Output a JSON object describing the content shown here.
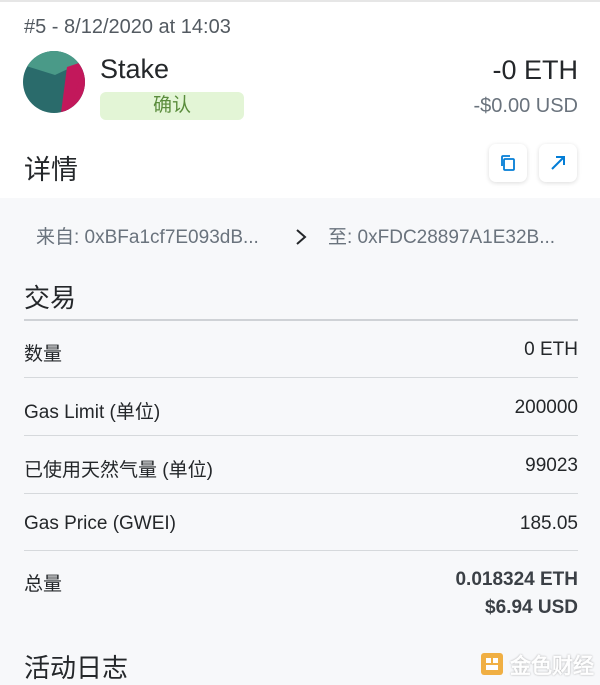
{
  "header": {
    "txn_id": "#5 - 8/12/2020 at 14:03",
    "title": "Stake",
    "status": "确认",
    "amount": "-0 ETH",
    "fiat_amount": "-$0.00 USD"
  },
  "details": {
    "title": "详情",
    "from": "来自: 0xBFa1cf7E093dB...",
    "to": "至: 0xFDC28897A1E32B..."
  },
  "transaction": {
    "title": "交易",
    "rows": [
      {
        "label": "数量",
        "value": "0 ETH"
      },
      {
        "label": "Gas Limit (单位)",
        "value": "200000"
      },
      {
        "label": "已使用天然气量 (单位)",
        "value": "99023"
      },
      {
        "label": "Gas Price (GWEI)",
        "value": "185.05"
      },
      {
        "label": "总量",
        "value": "0.018324 ETH",
        "value2": "$6.94 USD"
      }
    ]
  },
  "activity": {
    "title": "活动日志"
  },
  "watermark": {
    "text": "金色财经"
  },
  "colors": {
    "badge_bg": "#e3f5d6",
    "badge_text": "#5a8c3c",
    "accent": "#037dd6",
    "avatar_teal": "#2a6b6b",
    "avatar_pink": "#c2185b",
    "avatar_light": "#4a9a88"
  },
  "icons": {
    "copy": "copy-icon",
    "link": "external-link-icon",
    "arrow": "chevron-right-icon"
  }
}
